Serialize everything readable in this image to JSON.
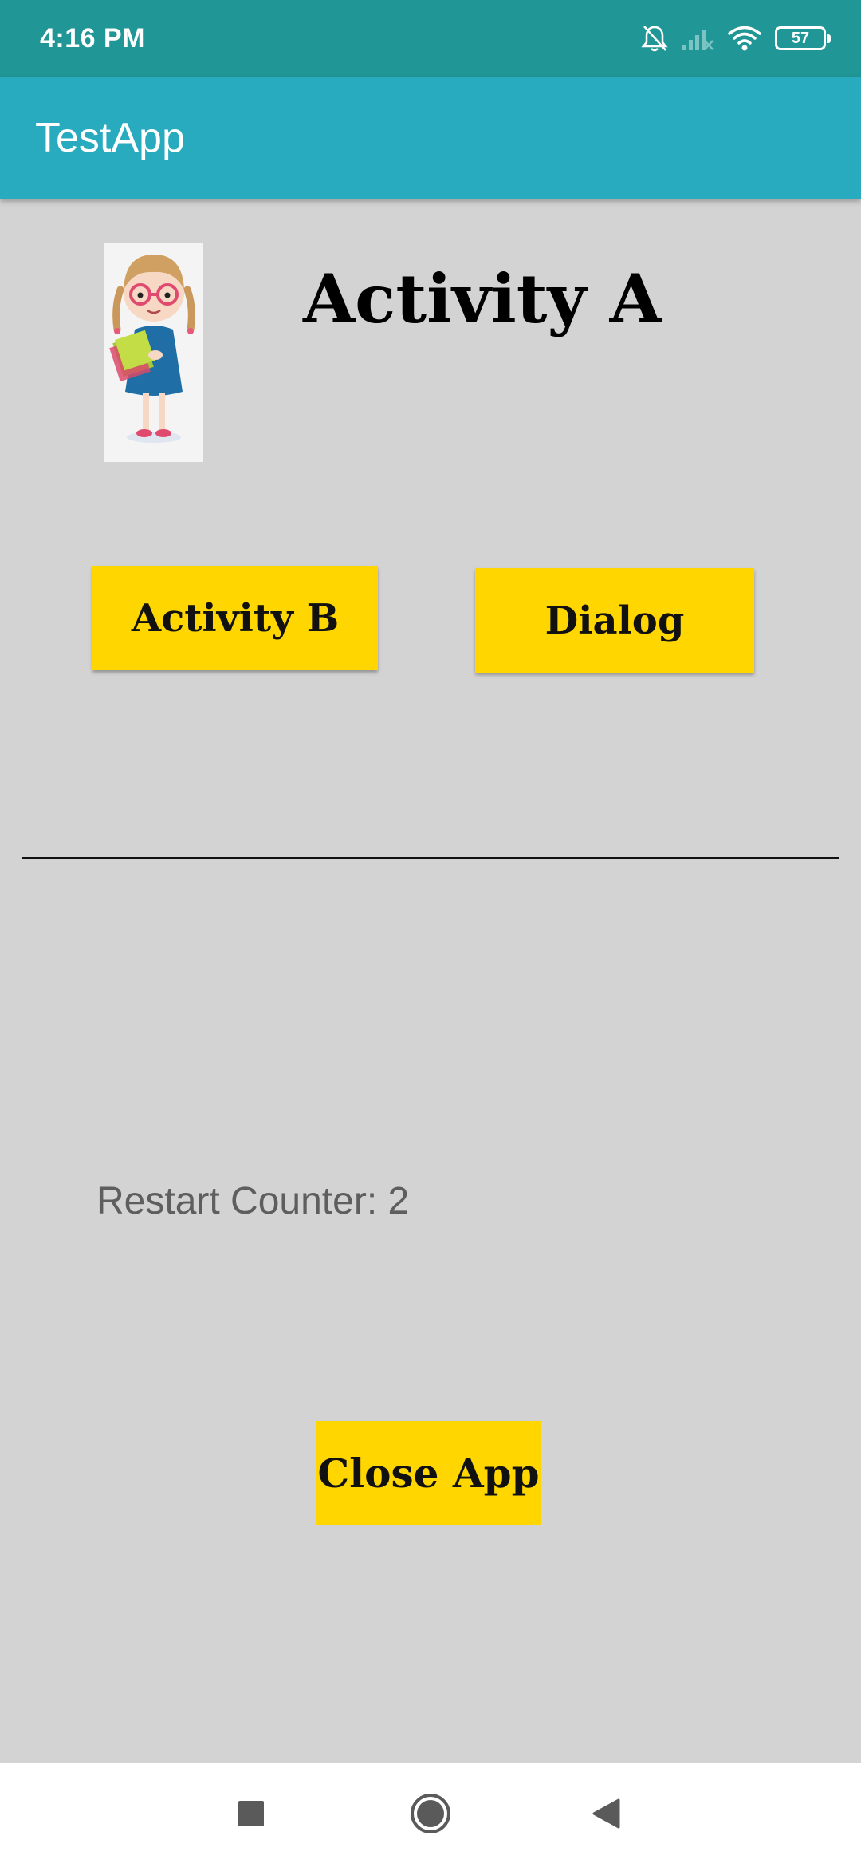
{
  "status_bar": {
    "time": "4:16 PM",
    "battery_level": "57",
    "icons": [
      "bell-muted-icon",
      "signal-off-icon",
      "wifi-icon",
      "battery-icon"
    ]
  },
  "app_bar": {
    "title": "TestApp"
  },
  "main": {
    "image": "girl-with-books-icon",
    "heading": "Activity A",
    "buttons": {
      "activity_b": "Activity B",
      "dialog": "Dialog",
      "close_app": "Close App"
    },
    "restart_counter": "Restart Counter: 2"
  },
  "navigation": {
    "icons": [
      "recents-square-icon",
      "home-circle-icon",
      "back-triangle-icon"
    ]
  },
  "colors": {
    "status_bar": "#219696",
    "app_bar": "#28abbf",
    "background": "#d3d3d3",
    "button": "#ffd600",
    "counter_text": "#5e5e5e"
  }
}
